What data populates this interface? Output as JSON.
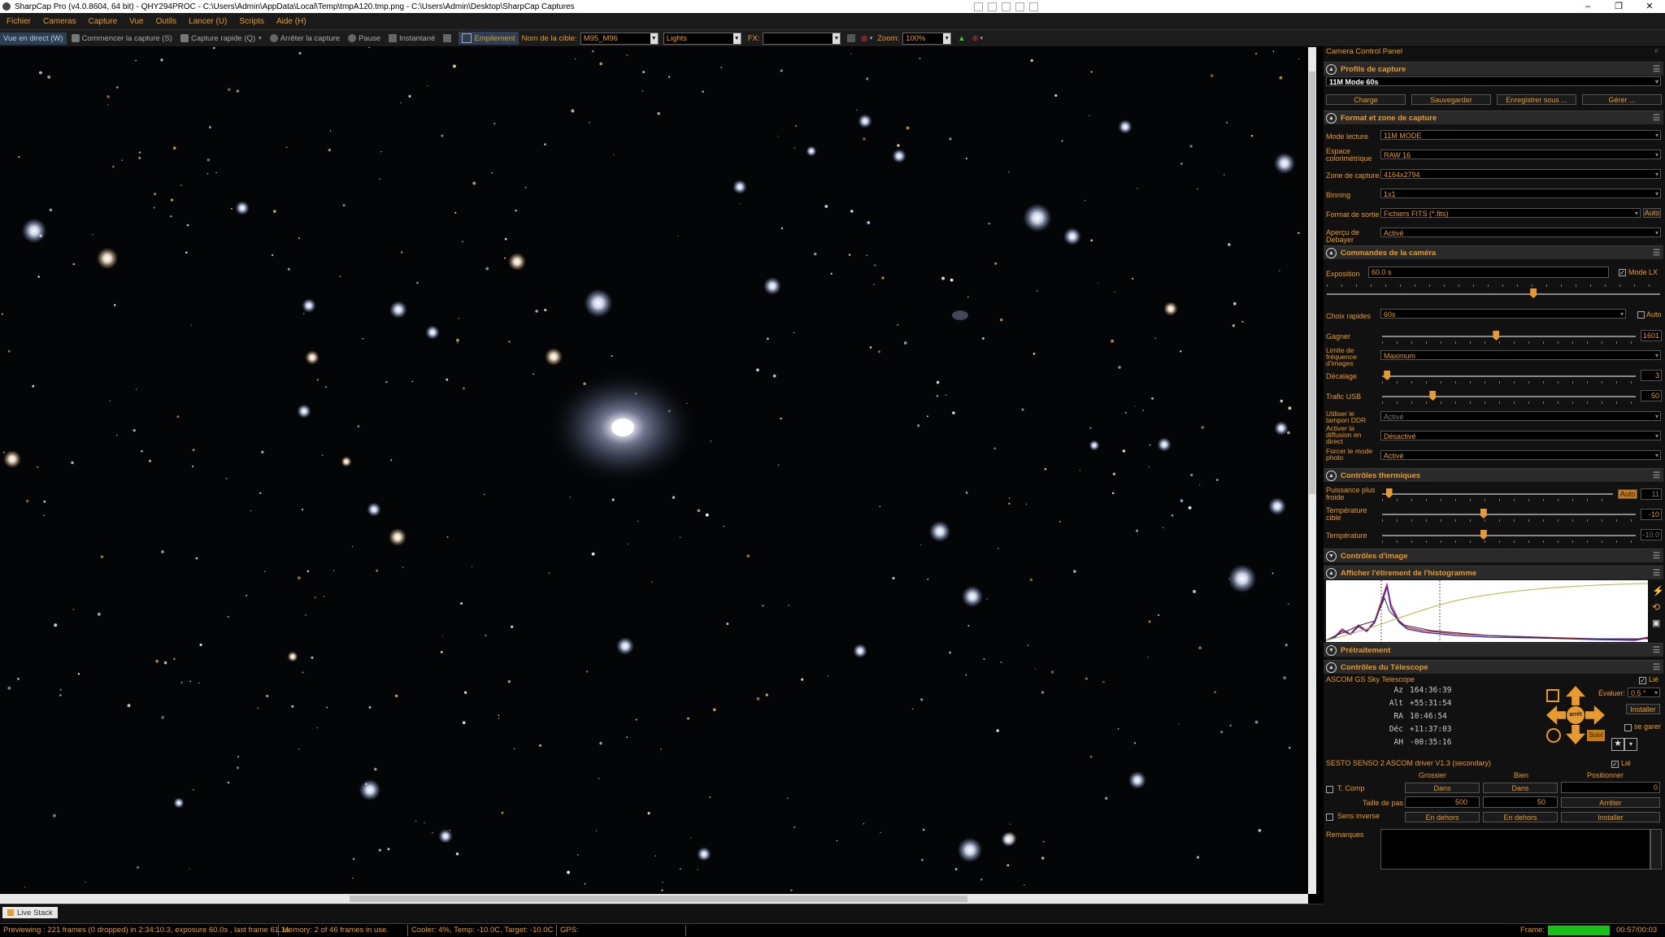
{
  "window": {
    "title": "SharpCap Pro (v4.0.8604, 64 bit) - QHY294PROC - C:\\Users\\Admin\\AppData\\Local\\Temp\\tmpA120.tmp.png - C:\\Users\\Admin\\Desktop\\SharpCap Captures",
    "min": "–",
    "max": "❐",
    "close": "✕"
  },
  "menu": [
    "Fichier",
    "Cameras",
    "Capture",
    "Vue",
    "Outils",
    "Lancer (U)",
    "Scripts",
    "Aide (H)"
  ],
  "toolbar": {
    "live_view": "Vue en direct (W)",
    "start_capture": "Commencer la capture (S)",
    "quick_capture": "Capture rapide (Q)",
    "stop_capture": "Arrêter la capture",
    "pause": "Pause",
    "snapshot": "Instantané",
    "stacking": "Empilement",
    "target_label": "Nom de la cible:",
    "target_value": "M95_M96",
    "frame_type": "Lights",
    "fx_label": "FX:",
    "fx_value": "",
    "zoom_label": "Zoom:",
    "zoom_value": "100%"
  },
  "panel": {
    "title": "Camera Control Panel",
    "profiles": {
      "header": "Profils de capture",
      "selected": "11M Mode 60s",
      "buttons": [
        "Charge",
        "Sauvegarder",
        "Enregistrer sous ...",
        "Gérer ..."
      ]
    },
    "format": {
      "header": "Format et zone de capture",
      "rows": [
        {
          "label": "Mode lecture",
          "value": "11M MODE"
        },
        {
          "label": "Espace colorimétrique",
          "value": "RAW 16"
        },
        {
          "label": "Zone de capture",
          "value": "4164x2794"
        },
        {
          "label": "Binning",
          "value": "1x1"
        },
        {
          "label": "Format de sortie",
          "value": "Fichiers FITS (*.fits)",
          "extra": "Auto"
        },
        {
          "label": "Aperçu de Debayer",
          "value": "Activé"
        }
      ]
    },
    "camera": {
      "header": "Commandes de la caméra",
      "exposure_label": "Exposition",
      "exposure_value": "60.0 s",
      "lx_label": "Mode LX",
      "quick_label": "Choix rapides",
      "quick_value": "60s",
      "quick_auto": "Auto",
      "gain_label": "Gagner",
      "gain_value": "1601",
      "gain_level": 0.45,
      "framerate_label": "Limite de fréquence d'images",
      "framerate_value": "Maximum",
      "offset_label": "Décalage",
      "offset_value": "3",
      "offset_level": 0.02,
      "usb_label": "Trafic USB",
      "usb_value": "50",
      "usb_level": 0.2,
      "ddr_label": "Utiliser le tampon DDR",
      "ddr_value": "Activé",
      "broadcast_label": "Activer la diffusion en direct",
      "broadcast_value": "Désactivé",
      "photo_label": "Forcer le mode photo",
      "photo_value": "Activé",
      "exposure_level": 0.62
    },
    "thermal": {
      "header": "Contrôles thermiques",
      "power_label": "Puissance plus froide",
      "power_auto": "Auto",
      "power_value": "11",
      "power_level": 0.03,
      "target_label": "Température cible",
      "target_value": "-10",
      "target_level": 0.4,
      "temp_label": "Température",
      "temp_value": "-10.0",
      "temp_level": 0.4
    },
    "image_header": "Contrôles d'image",
    "histogram_header": "Afficher l'étirement de l'histogramme",
    "preprocess_header": "Prétraitement",
    "telescope": {
      "header": "Contrôles du Télescope",
      "driver": "ASCOM GS Sky Telescope",
      "linked": "Lié",
      "coords": [
        {
          "k": "Az",
          "v": "164:36:39"
        },
        {
          "k": "Alt",
          "v": "+55:31:54"
        },
        {
          "k": "RA",
          "v": "10:46:54"
        },
        {
          "k": "Déc",
          "v": "+11:37:03"
        },
        {
          "k": "AH",
          "v": "-00:35:16"
        }
      ],
      "rate_label": "Évaluer:",
      "rate_value": "0.5 °",
      "install": "Installer",
      "park": "se garer",
      "stop": "arrêt",
      "follow": "Suivi"
    },
    "focuser": {
      "driver": "SESTO SENSO 2 ASCOM driver V1.3 (secondary)",
      "linked": "Lié",
      "col_coarse": "Grossier",
      "col_fine": "Bien",
      "col_pos": "Positionner",
      "tcomp": "T. Comp",
      "in1": "Dans",
      "in2": "Dans",
      "pos_value": "0",
      "step_label": "Taille de pas",
      "step_coarse": "500",
      "step_fine": "50",
      "stop": "Arrêter",
      "reverse": "Sens inverse",
      "out1": "En dehors",
      "out2": "En dehors",
      "install": "Installer"
    },
    "notes_label": "Remarques"
  },
  "livestack_tab": "Live Stack",
  "status": {
    "preview": "Previewing : 221 frames (0 dropped) in 2:34:10.3, exposure 60.0s , last frame 61.1s",
    "memory": "Memory: 2 of 46 frames in use.",
    "cooler": "Cooler: 4%, Temp: -10.0C, Target: -10.0C",
    "gps": "GPS:",
    "frame_label": "Frame:",
    "time": "00:57/00:03"
  }
}
